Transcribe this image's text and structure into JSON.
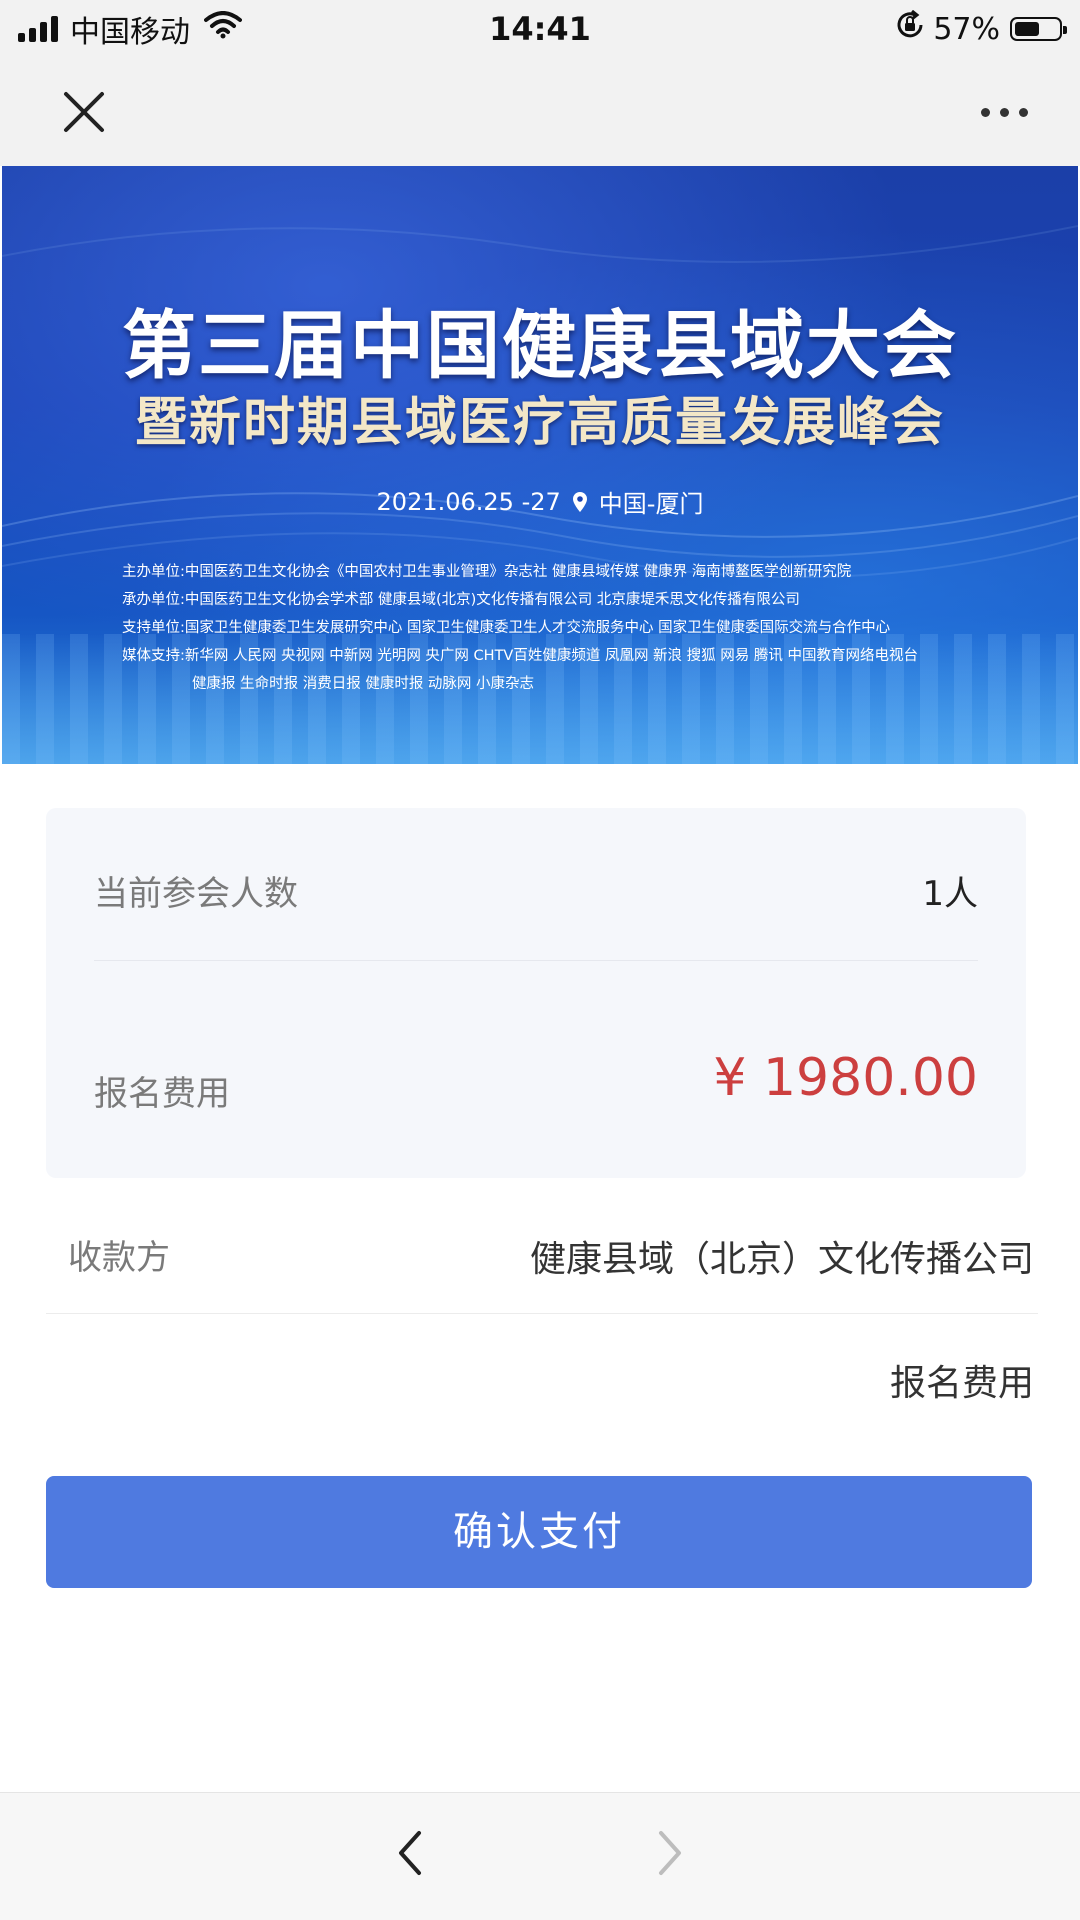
{
  "status_bar": {
    "carrier": "中国移动",
    "time": "14:41",
    "battery_percent": "57%",
    "battery_level": 0.57,
    "icons": [
      "signal-icon",
      "wifi-icon",
      "orientation-lock-icon",
      "battery-icon"
    ]
  },
  "nav": {
    "icons": [
      "close-icon",
      "more-icon"
    ]
  },
  "banner": {
    "title": "第三届中国健康县域大会",
    "subtitle": "暨新时期县域医疗高质量发展峰会",
    "date": "2021.06.25 -27",
    "location": "中国-厦门",
    "orgs": [
      "主办单位:中国医药卫生文化协会《中国农村卫生事业管理》杂志社  健康县域传媒  健康界  海南博鳌医学创新研究院",
      "承办单位:中国医药卫生文化协会学术部  健康县域(北京)文化传播有限公司  北京康堤禾思文化传播有限公司",
      "支持单位:国家卫生健康委卫生发展研究中心  国家卫生健康委卫生人才交流服务中心  国家卫生健康委国际交流与合作中心",
      "媒体支持:新华网  人民网  央视网  中新网  光明网  央广网  CHTV百姓健康频道  凤凰网  新浪  搜狐  网易  腾讯  中国教育网络电视台",
      "健康报  生命时报  消费日报  健康时报  动脉网  小康杂志"
    ]
  },
  "order": {
    "attendees_label": "当前参会人数",
    "attendees_value": "1人",
    "fee_label": "报名费用",
    "fee_value": "¥ 1980.00",
    "payee_label": "收款方",
    "payee_value": "健康县域（北京）文化传播公司",
    "description_value": "报名费用"
  },
  "actions": {
    "confirm_pay": "确认支付"
  },
  "bottom_bar": {
    "icons": [
      "back-icon",
      "forward-icon"
    ]
  },
  "colors": {
    "accent_button": "#4f7ae0",
    "price_red": "#cc3f3f",
    "banner_blue": "#1a43b4",
    "card_bg": "#f5f7fb"
  }
}
